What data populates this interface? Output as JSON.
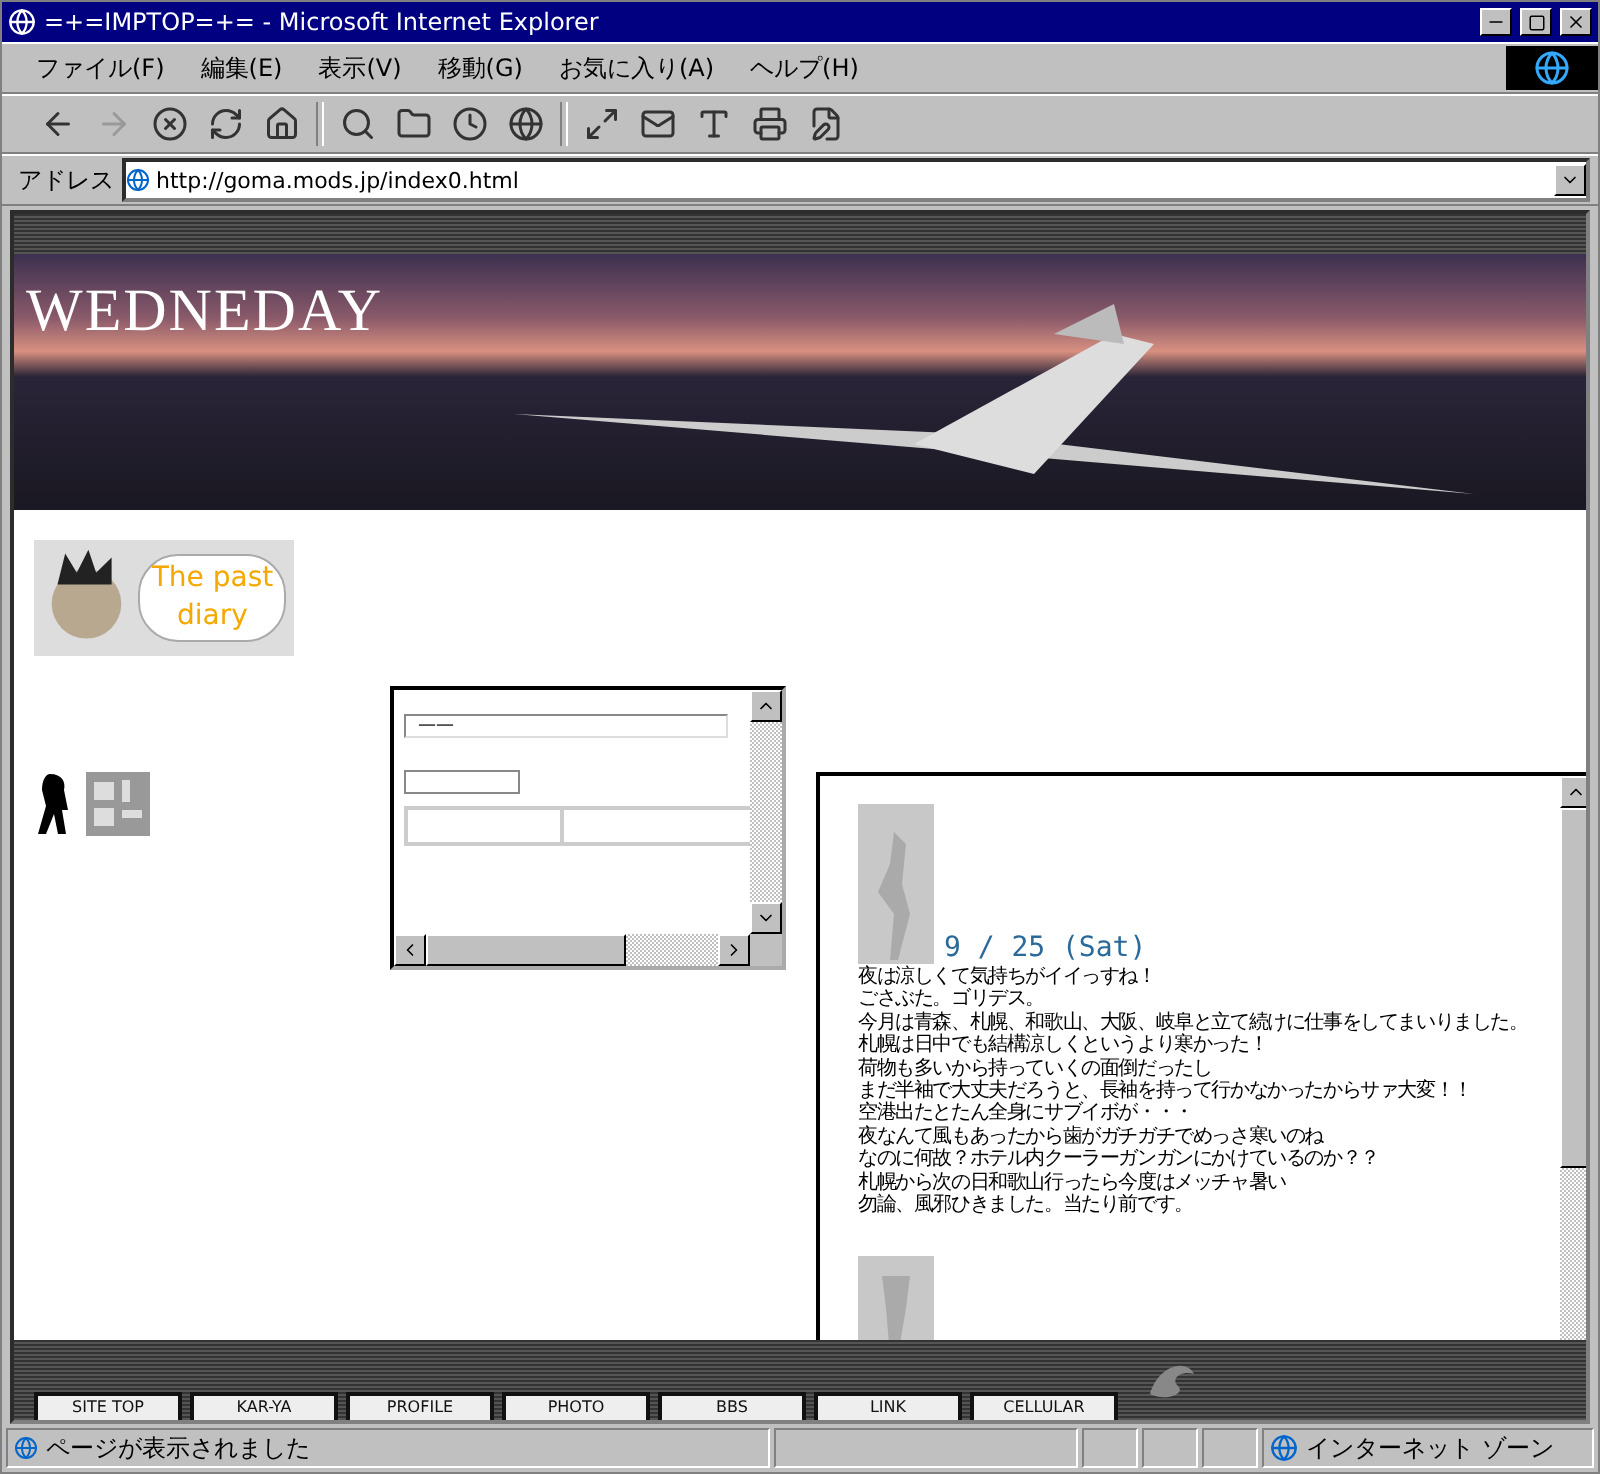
{
  "window": {
    "title": "=+=IMPTOP=+= - Microsoft Internet Explorer"
  },
  "menu": [
    "ファイル(F)",
    "編集(E)",
    "表示(V)",
    "移動(G)",
    "お気に入り(A)",
    "ヘルプ(H)"
  ],
  "address": {
    "label": "アドレス",
    "value": "http://goma.mods.jp/index0.html"
  },
  "banner": {
    "title": "WEDNEDAY"
  },
  "past_diary": {
    "label": "The past diary"
  },
  "small_frame": {
    "field_text": "——"
  },
  "diary": {
    "date": "9 / 25 (Sat)",
    "lines": [
      "夜は涼しくて気持ちがイイっすね！",
      "ごさぶた。ゴリデス。",
      "今月は青森、札幌、和歌山、大阪、岐阜と立て続けに仕事をしてまいりました。",
      "札幌は日中でも結構涼しくというより寒かった！",
      "荷物も多いから持っていくの面倒だったし",
      "まだ半袖で大丈夫だろうと、長袖を持って行かなかったからサァ大変！！",
      "空港出たとたん全身にサブイボが・・・",
      "夜なんて風もあったから歯がガチガチでめっさ寒いのね",
      "なのに何故？ホテル内クーラーガンガンにかけているのか？？",
      "札幌から次の日和歌山行ったら今度はメッチャ暑い",
      "勿論、風邪ひきました。当たり前です。"
    ]
  },
  "nav": [
    "SITE TOP",
    "KAR-YA",
    "PROFILE",
    "PHOTO",
    "BBS",
    "LINK",
    "CELLULAR"
  ],
  "status": {
    "text": "ページが表示されました",
    "zone": "インターネット ゾーン"
  }
}
